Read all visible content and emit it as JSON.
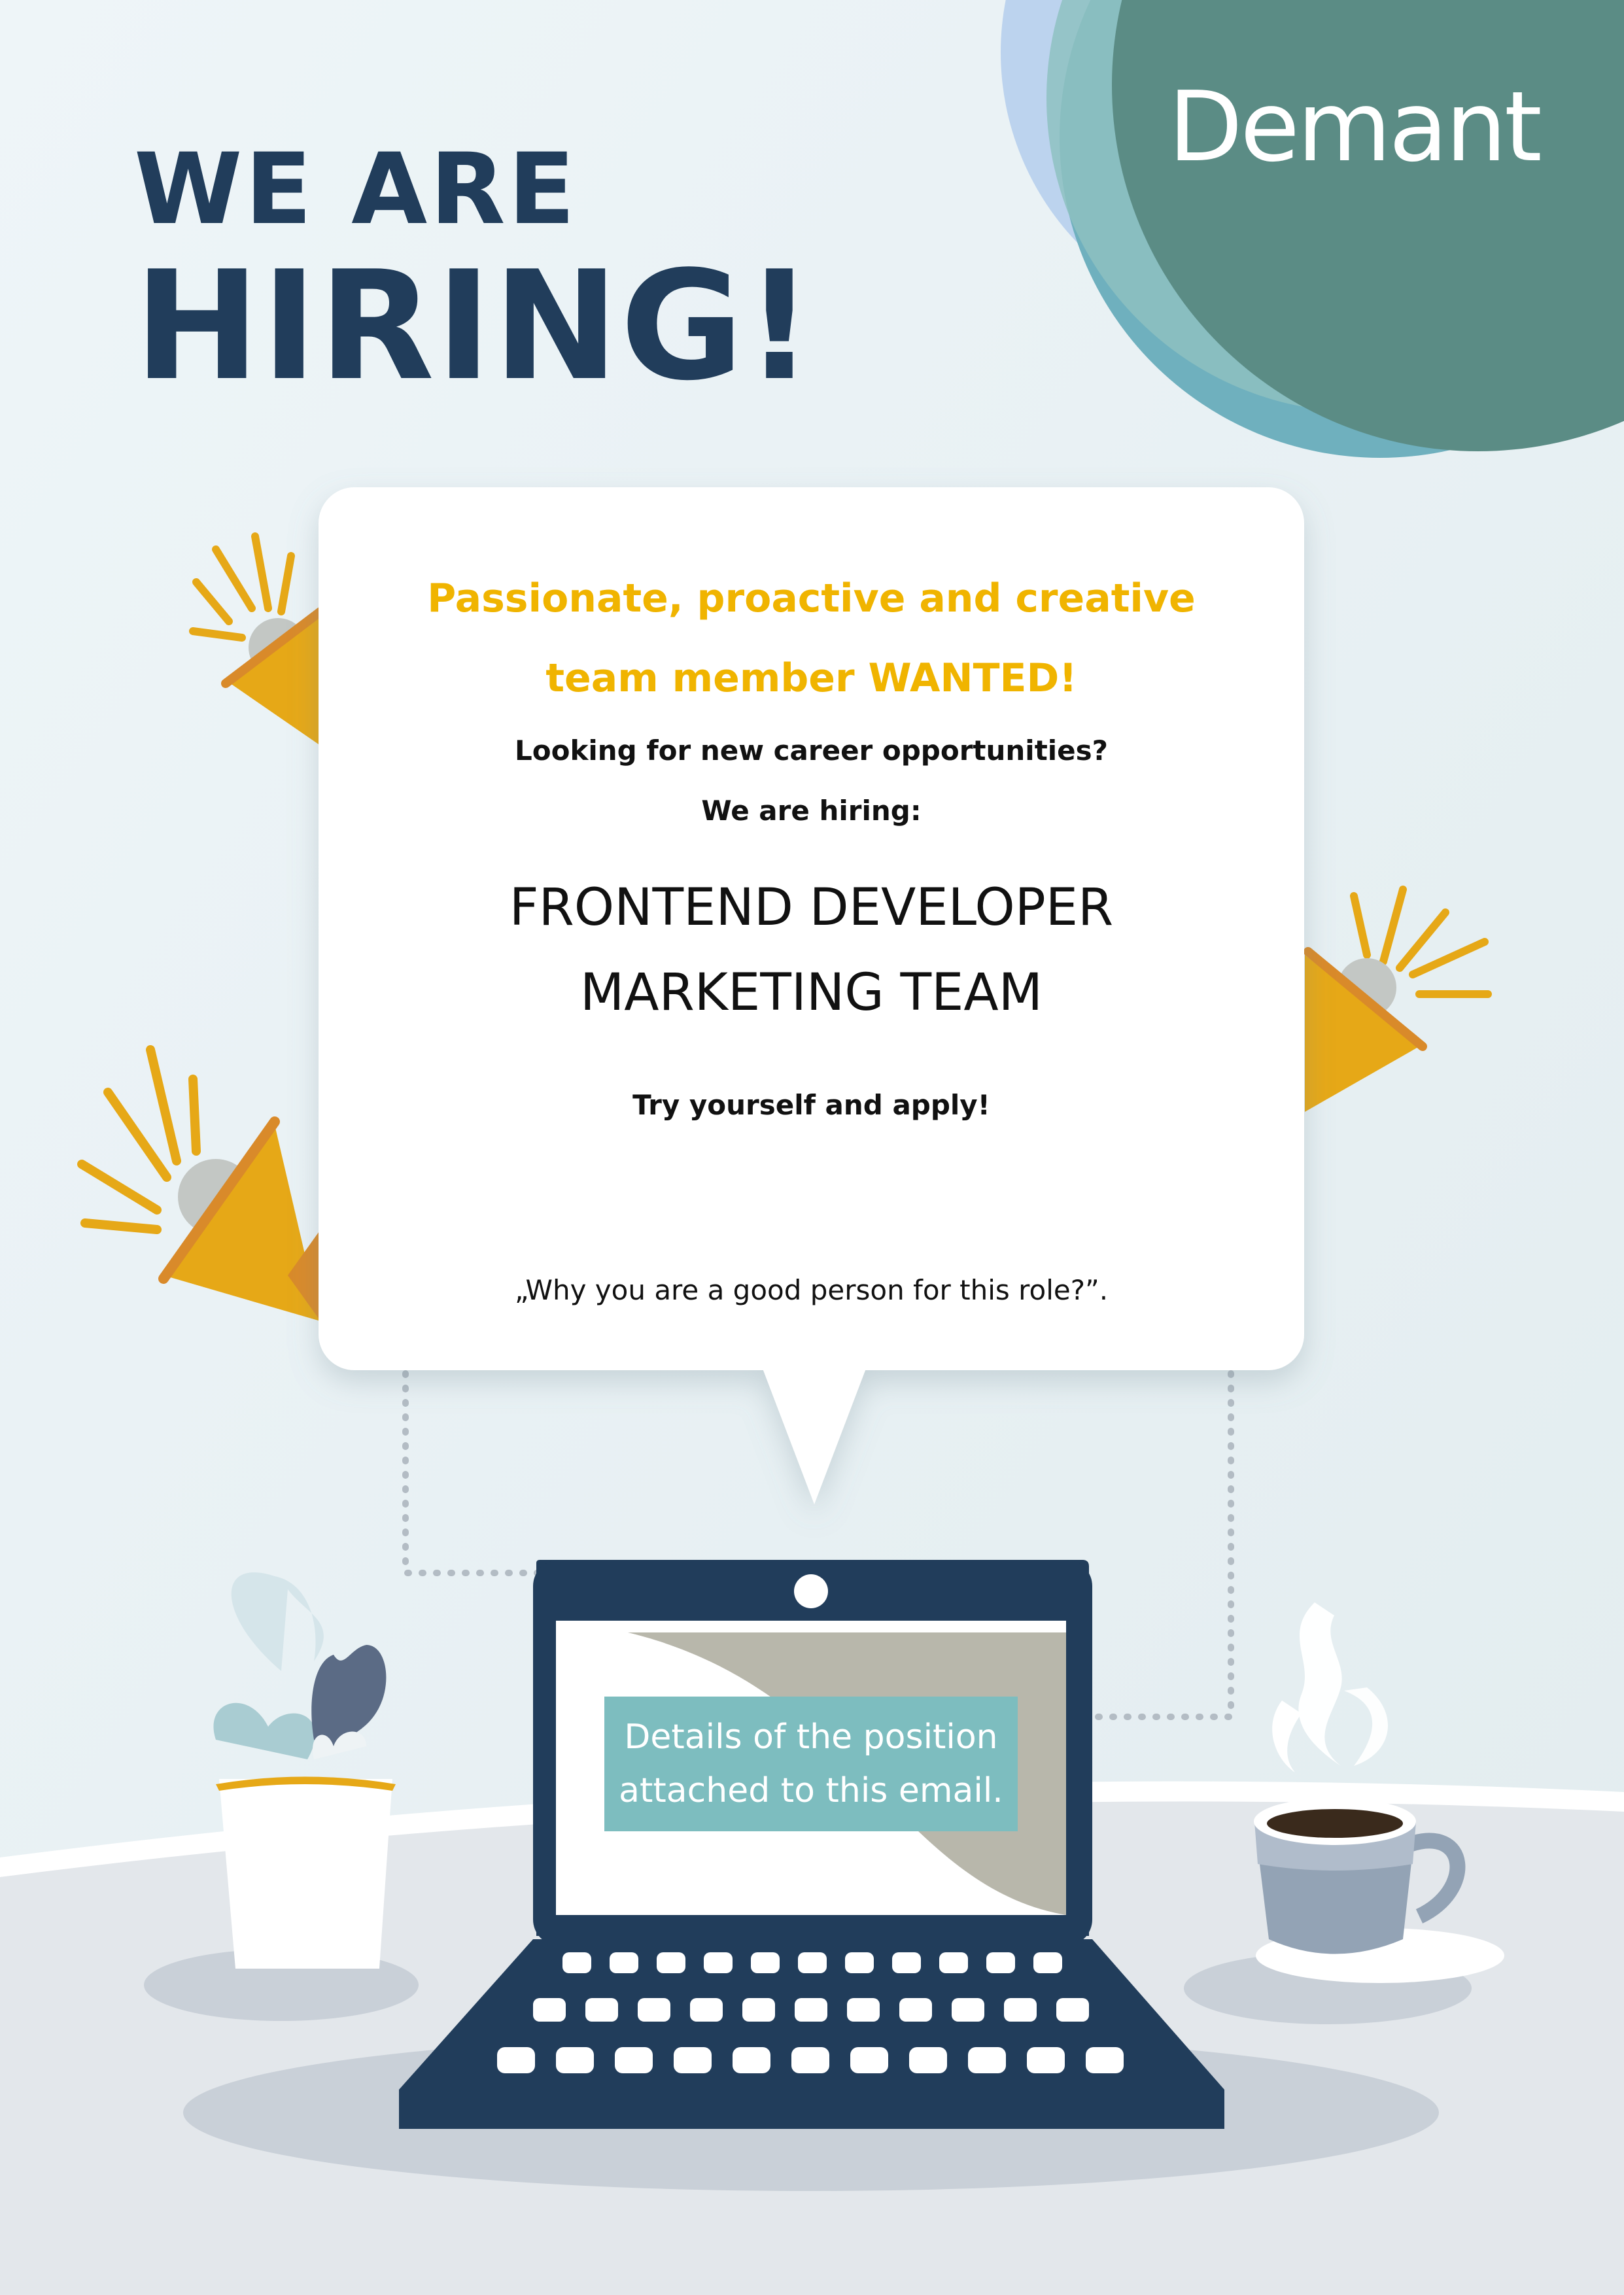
{
  "headline": {
    "line1": "WE ARE",
    "line2": "HIRING!"
  },
  "brand": {
    "name": "Demant"
  },
  "bubble": {
    "tagline_line1": "Passionate, proactive and creative",
    "tagline_line2": "team member WANTED!",
    "question1": "Looking for new career opportunities?",
    "question2": "We are hiring:",
    "role_line1": "FRONTEND DEVELOPER",
    "role_line2": "MARKETING TEAM",
    "cta": "Try yourself and apply!",
    "quote": "„Why you are a good person for this role?”."
  },
  "laptop": {
    "details_line1": "Details of the position",
    "details_line2": "attached to this email."
  },
  "colors": {
    "navy": "#213d5b",
    "teal": "#5b8c85",
    "yellow": "#f0b400",
    "orange": "#e6a817",
    "details_box": "#7dbdbf",
    "background": "#e8f1f4"
  },
  "icons": [
    "megaphone-icon",
    "plant-pot-icon",
    "laptop-icon",
    "coffee-cup-icon",
    "steam-icon"
  ]
}
